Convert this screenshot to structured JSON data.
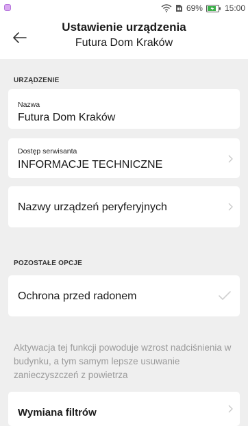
{
  "status_bar": {
    "battery_percent": "69%",
    "time": "15:00"
  },
  "header": {
    "title": "Ustawienie urządzenia",
    "subtitle": "Futura Dom Kraków"
  },
  "sections": {
    "device_label": "URZĄDZENIE",
    "other_label": "POZOSTAŁE OPCJE"
  },
  "device": {
    "name_label": "Nazwa",
    "name_value": "Futura Dom Kraków",
    "service_label": "Dostęp serwisanta",
    "service_value": "INFORMACJE TECHNICZNE",
    "peripherals": "Nazwy urządzeń peryferyjnych"
  },
  "options": {
    "radon_label": "Ochrona przed radonem",
    "radon_checked": true,
    "radon_description": "Aktywacja tej funkcji powoduje wzrost nadciśnienia w budynku, a tym samym lepsze usuwanie zanieczyszczeń z powietrza",
    "filters_label": "Wymiana filtrów"
  },
  "colors": {
    "background": "#efefef",
    "card": "#ffffff",
    "muted_text": "#9a9a9a",
    "chevron": "#c8c8c8"
  }
}
